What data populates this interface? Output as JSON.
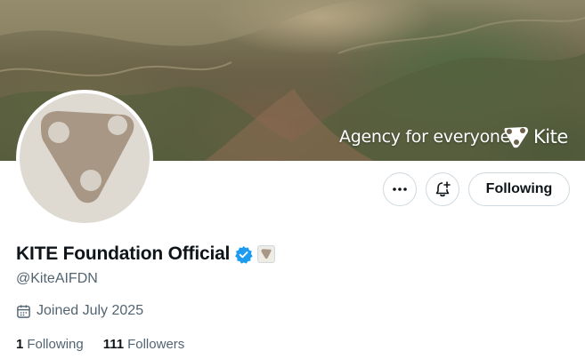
{
  "banner": {
    "tagline": "Agency for everyone.",
    "logo_text": "Kite"
  },
  "profile": {
    "display_name": "KITE Foundation Official",
    "handle": "@KiteAIFDN",
    "joined": "Joined July 2025",
    "verified_color": "#1d9bf0"
  },
  "actions": {
    "more_icon": "more-icon",
    "notify_icon": "bell-plus-icon",
    "following_label": "Following"
  },
  "stats": {
    "following_count": "1",
    "following_label": "Following",
    "followers_count": "111",
    "followers_label": "Followers"
  }
}
